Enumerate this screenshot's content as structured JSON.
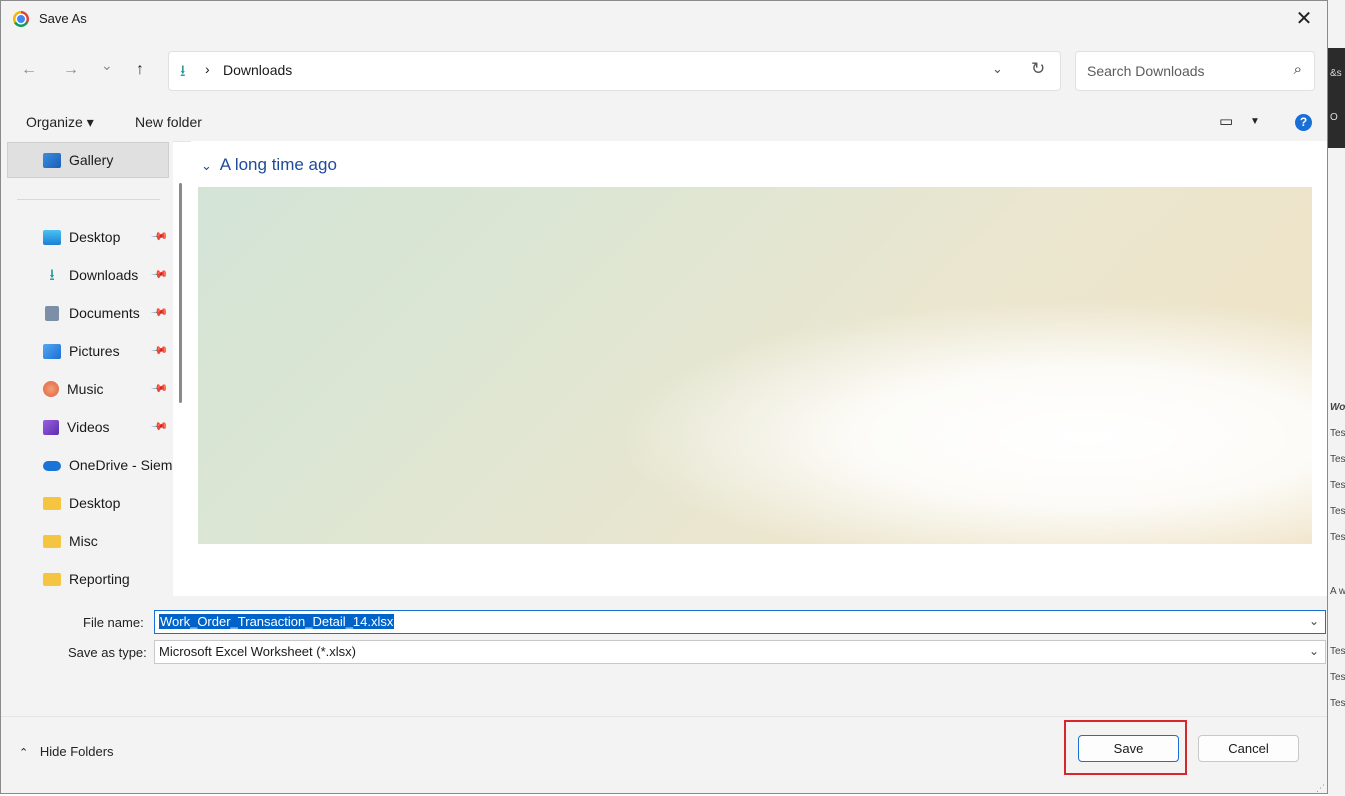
{
  "window": {
    "title": "Save As",
    "close_glyph": "✕",
    "app_icon": "chrome-icon"
  },
  "nav": {
    "back_glyph": "←",
    "forward_glyph": "→",
    "recent_glyph": "⌄",
    "up_glyph": "↑",
    "breadcrumb_icon_glyph": "⭳",
    "breadcrumb_sep": "›",
    "breadcrumb": "Downloads",
    "dropdown_glyph": "⌄",
    "refresh_glyph": "↻"
  },
  "search": {
    "placeholder": "Search Downloads",
    "icon_glyph": "⌕"
  },
  "toolbar": {
    "organize_label": "Organize ▾",
    "new_folder_label": "New folder",
    "view_glyph": "▭",
    "view_caret": "▼",
    "help_glyph": "?"
  },
  "sidebar": {
    "pin_glyph": "📌",
    "items": [
      {
        "label": "Gallery",
        "icon": "gallery-icon"
      },
      {
        "label": "Desktop",
        "icon": "desktop-icon",
        "pinned": true
      },
      {
        "label": "Downloads",
        "icon": "download-icon",
        "pinned": true
      },
      {
        "label": "Documents",
        "icon": "documents-icon",
        "pinned": true
      },
      {
        "label": "Pictures",
        "icon": "pictures-icon",
        "pinned": true
      },
      {
        "label": "Music",
        "icon": "music-icon",
        "pinned": true
      },
      {
        "label": "Videos",
        "icon": "videos-icon",
        "pinned": true
      },
      {
        "label": "OneDrive - Siem",
        "icon": "onedrive-icon"
      },
      {
        "label": "Desktop",
        "icon": "folder-icon"
      },
      {
        "label": "Misc",
        "icon": "folder-icon"
      },
      {
        "label": "Reporting",
        "icon": "folder-icon"
      }
    ]
  },
  "content": {
    "group_chevron": "⌄",
    "group_header": "A long time ago"
  },
  "form": {
    "file_name_label": "File name:",
    "file_name_value": "Work_Order_Transaction_Detail_14.xlsx",
    "save_type_label": "Save as type:",
    "save_type_value": "Microsoft Excel Worksheet (*.xlsx)",
    "dropdown_glyph": "⌄"
  },
  "footer": {
    "hide_folders_chevron": "⌃",
    "hide_folders_label": "Hide Folders",
    "save_label": "Save",
    "cancel_label": "Cancel"
  },
  "background_app": {
    "fragments": [
      "&s",
      "O",
      "Wo",
      "Tes",
      "Tes",
      "Tes",
      "Tes",
      "Tes",
      "A w",
      "Tes",
      "Tes",
      "Tes"
    ]
  },
  "colors": {
    "accent": "#1a6fd6",
    "highlight_box": "#d9252c",
    "selection": "#0063c9"
  }
}
